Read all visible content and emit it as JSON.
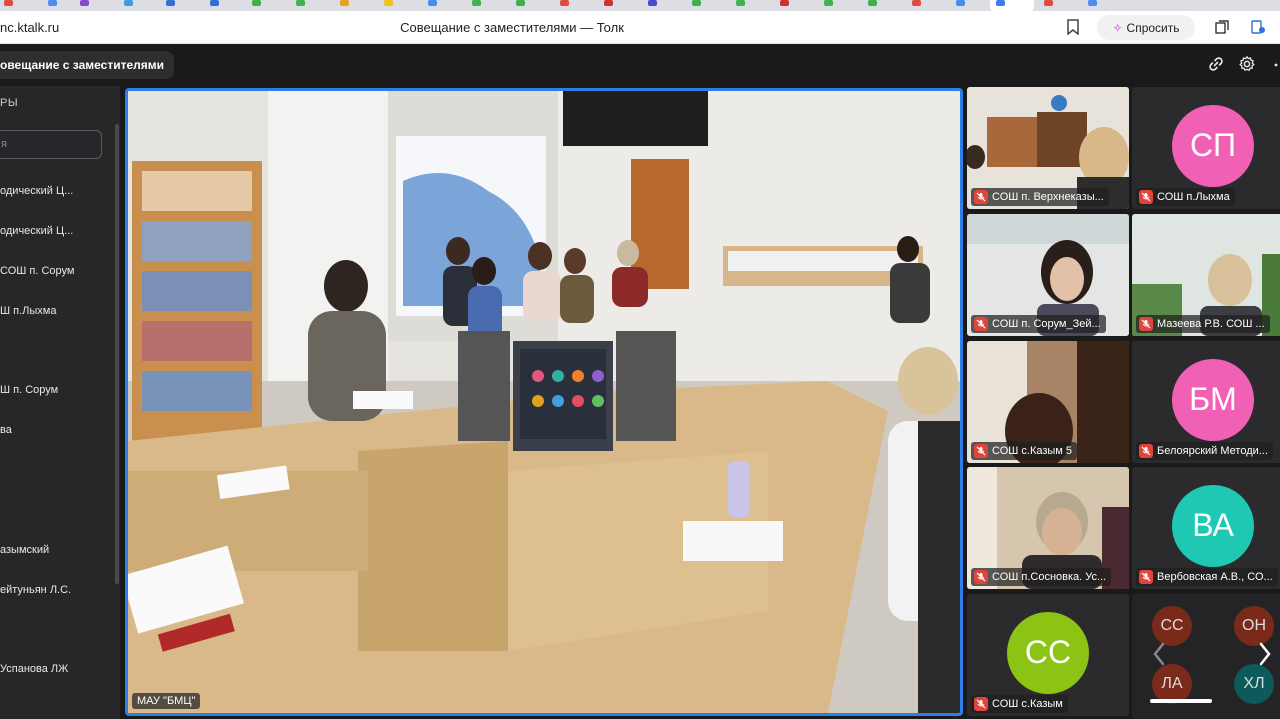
{
  "browser": {
    "url": "nc.ktalk.ru",
    "page_title": "Совещание с заместителями — Толк",
    "ask_label": "Спросить"
  },
  "meeting": {
    "title": "овещание с заместителями"
  },
  "sidebar": {
    "heading": "РЫ",
    "search_placeholder": "я",
    "items": [
      "одический Ц...",
      "одический Ц...",
      "СОШ п. Сорум",
      "Ш п.Лыхма",
      "Ш п. Сорум",
      "ва",
      "азымский",
      "ейтуньян Л.С.",
      "Успанова ЛЖ"
    ]
  },
  "main_video": {
    "label": "МАУ \"БМЦ\""
  },
  "tiles": [
    {
      "name": "СОШ п. Верхнеказы...",
      "type": "video"
    },
    {
      "name": "СОШ п.Лыхма",
      "type": "avatar",
      "initials": "СП",
      "color": "#f061b6"
    },
    {
      "name": "СОШ п. Сорум_Зей...",
      "type": "video"
    },
    {
      "name": "Мазеева Р.В. СОШ ...",
      "type": "video"
    },
    {
      "name": "СОШ с.Казым 5",
      "type": "video"
    },
    {
      "name": "Белоярский Методи...",
      "type": "avatar",
      "initials": "БМ",
      "color": "#f061b6"
    },
    {
      "name": "СОШ п.Сосновка. Ус...",
      "type": "video"
    },
    {
      "name": "Вербовская А.В., СО...",
      "type": "avatar",
      "initials": "ВА",
      "color": "#1fc8b2"
    },
    {
      "name": "СОШ с.Казым",
      "type": "avatar",
      "initials": "СС",
      "color": "#8bc414"
    }
  ],
  "more_tile": {
    "initials": [
      "СС",
      "ОН",
      "ЛА",
      "ХЛ"
    ]
  }
}
